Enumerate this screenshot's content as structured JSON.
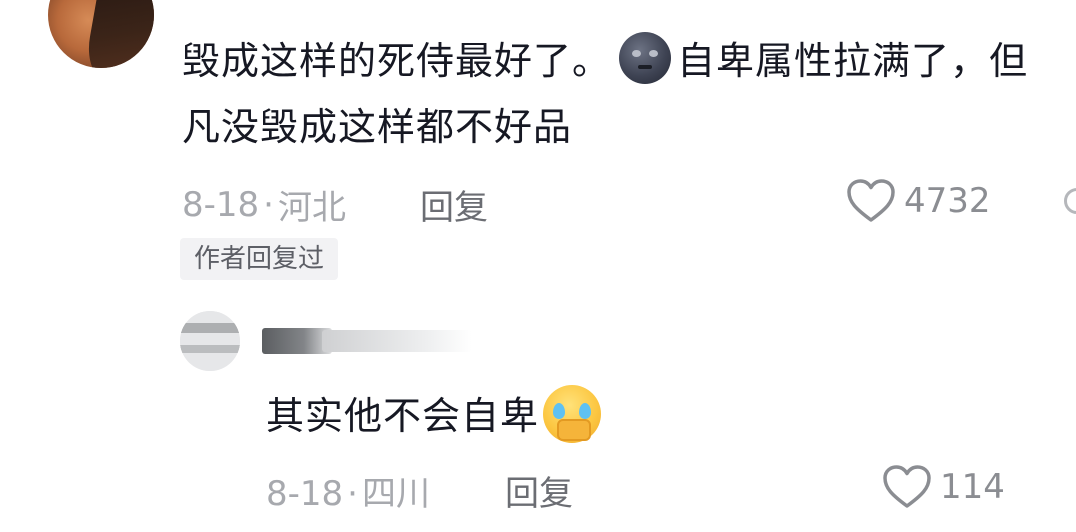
{
  "top_comment": {
    "text_part1": "毁成这样的死侍最好了。",
    "text_part2": "自卑属性拉满了，但凡没毁成这样都不好品",
    "inline_emoji": "new-moon-face-emoji",
    "date": "8-18",
    "dot": "·",
    "location": "河北",
    "reply_label": "回复",
    "like_count": "4732",
    "author_badge": "作者回复过"
  },
  "reply_comment": {
    "text": "其实他不会自卑",
    "inline_emoji": "crying-pleading-face-emoji",
    "date": "8-18",
    "dot": "·",
    "location": "四川",
    "reply_label": "回复",
    "like_count": "114"
  },
  "colors": {
    "text_primary": "#161823",
    "text_meta": "#a7a9ae",
    "reply_action": "#6b6d73",
    "badge_bg": "#f2f2f4"
  }
}
